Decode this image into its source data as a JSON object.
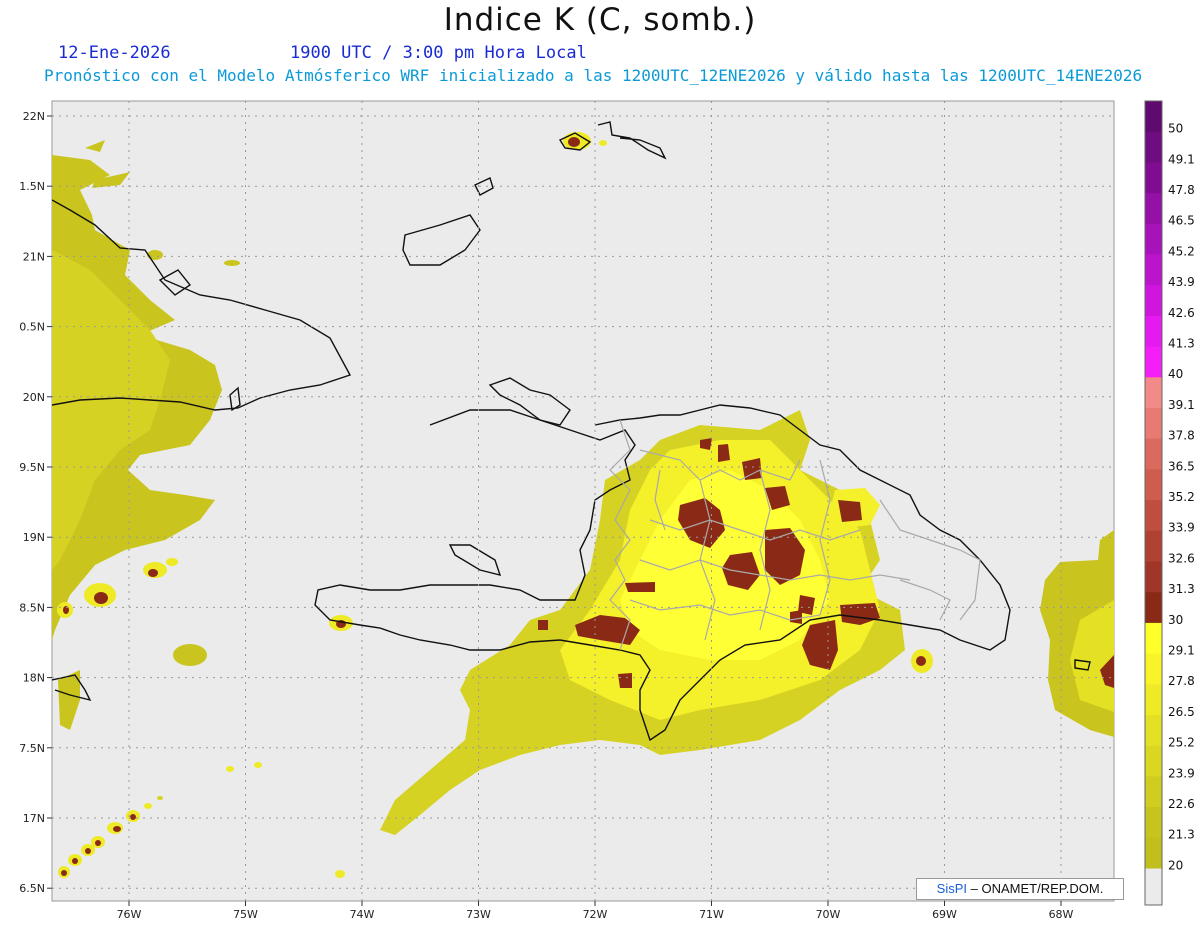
{
  "header": {
    "title": "Indice K (C, somb.)",
    "date": "12-Ene-2026",
    "time": "1900 UTC / 3:00 pm Hora Local",
    "subtitle": "Pronóstico con el Modelo Atmósferico WRF inicializado a las 1200UTC_12ENE2026 y válido hasta las  1200UTC_14ENE2026"
  },
  "map": {
    "lat_labels": [
      "22N",
      "1.5N",
      "21N",
      "0.5N",
      "20N",
      "9.5N",
      "19N",
      "8.5N",
      "18N",
      "7.5N",
      "17N",
      "6.5N"
    ],
    "lon_labels": [
      "76W",
      "75W",
      "74W",
      "73W",
      "72W",
      "71W",
      "70W",
      "69W",
      "68W"
    ]
  },
  "colorbar": {
    "labels": [
      "50",
      "49.1",
      "47.8",
      "46.5",
      "45.2",
      "43.9",
      "42.6",
      "41.3",
      "40",
      "39.1",
      "37.8",
      "36.5",
      "35.2",
      "33.9",
      "32.6",
      "31.3",
      "30",
      "29.1",
      "27.8",
      "26.5",
      "25.2",
      "23.9",
      "22.6",
      "21.3",
      "20"
    ],
    "colors": [
      "#5e0a6e",
      "#6e0c80",
      "#800c92",
      "#9410a6",
      "#a812ba",
      "#bc14cc",
      "#d016de",
      "#e41af0",
      "#f41ef8",
      "#f38a8a",
      "#e77a72",
      "#db6a5e",
      "#cf5c4c",
      "#c04e3e",
      "#b04232",
      "#a03628",
      "#8a2a16",
      "#ffff2a",
      "#f8f428",
      "#eeea26",
      "#e4e024",
      "#dad622",
      "#d0cc20",
      "#c8c41e",
      "#c2be1c"
    ]
  },
  "credit": {
    "brand": "SisPI",
    "text": "– ONAMET/REP.DOM."
  }
}
